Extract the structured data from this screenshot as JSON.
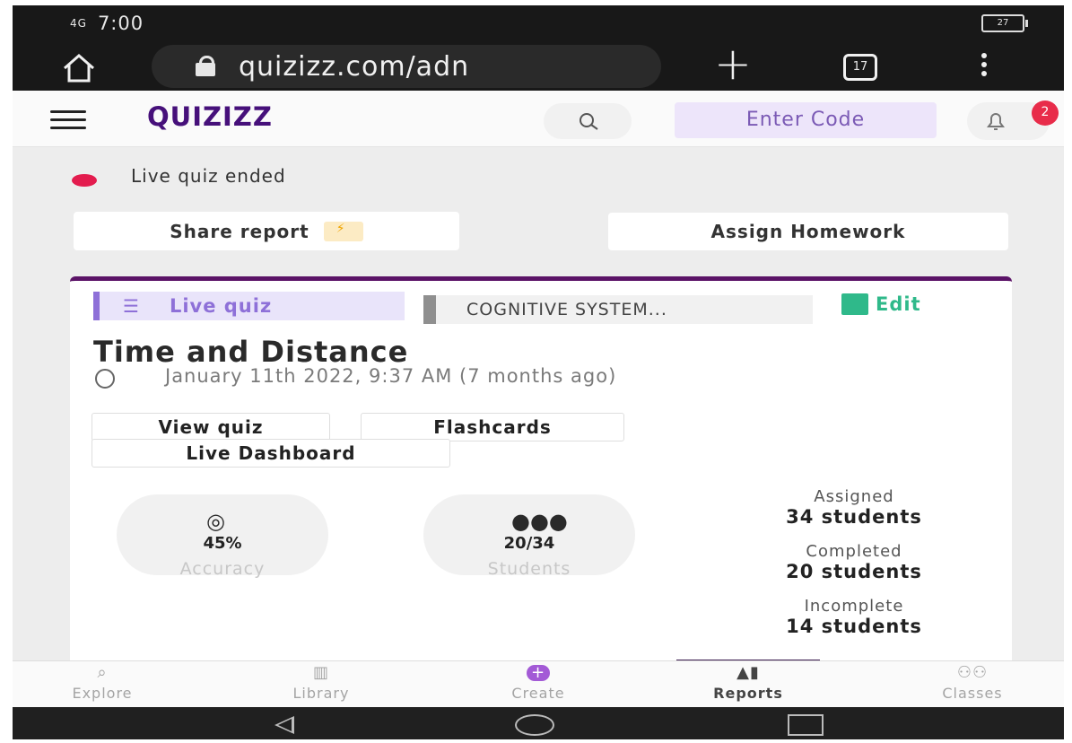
{
  "status": {
    "signal": "4G",
    "time": "7:00",
    "battery": "27"
  },
  "browser": {
    "url": "quizizz.com/adn",
    "tab_count": "17"
  },
  "header": {
    "logo": "QUIZIZZ",
    "enter_code": "Enter Code",
    "notifications": "2"
  },
  "status_line": {
    "text": "Live quiz ended"
  },
  "actions": {
    "share_report": "Share report",
    "assign_homework": "Assign Homework"
  },
  "card": {
    "tag": "Live quiz",
    "class_name": "COGNITIVE SYSTEM...",
    "edit": "Edit",
    "title": "Time and Distance",
    "date": "January 11th 2022, 9:37 AM (7 months ago)",
    "buttons": {
      "view_quiz": "View quiz",
      "flashcards": "Flashcards",
      "live_dashboard": "Live Dashboard"
    },
    "stats": {
      "accuracy_value": "45%",
      "accuracy_label": "Accuracy",
      "students_value": "20/34",
      "students_label": "Students"
    },
    "summary": {
      "assigned_label": "Assigned",
      "assigned_value": "34 students",
      "completed_label": "Completed",
      "completed_value": "20 students",
      "incomplete_label": "Incomplete",
      "incomplete_value": "14 students"
    }
  },
  "bottom_nav": {
    "items": [
      {
        "label": "Explore",
        "icon": "search-icon"
      },
      {
        "label": "Library",
        "icon": "library-icon"
      },
      {
        "label": "Create",
        "icon": "plus-icon"
      },
      {
        "label": "Reports",
        "icon": "chart-icon"
      },
      {
        "label": "Classes",
        "icon": "classes-icon"
      }
    ],
    "active": "Reports"
  },
  "colors": {
    "brand": "#46107a",
    "live_dot": "#e31c4e",
    "edit": "#2fb98a",
    "tag": "#8e70d8"
  }
}
